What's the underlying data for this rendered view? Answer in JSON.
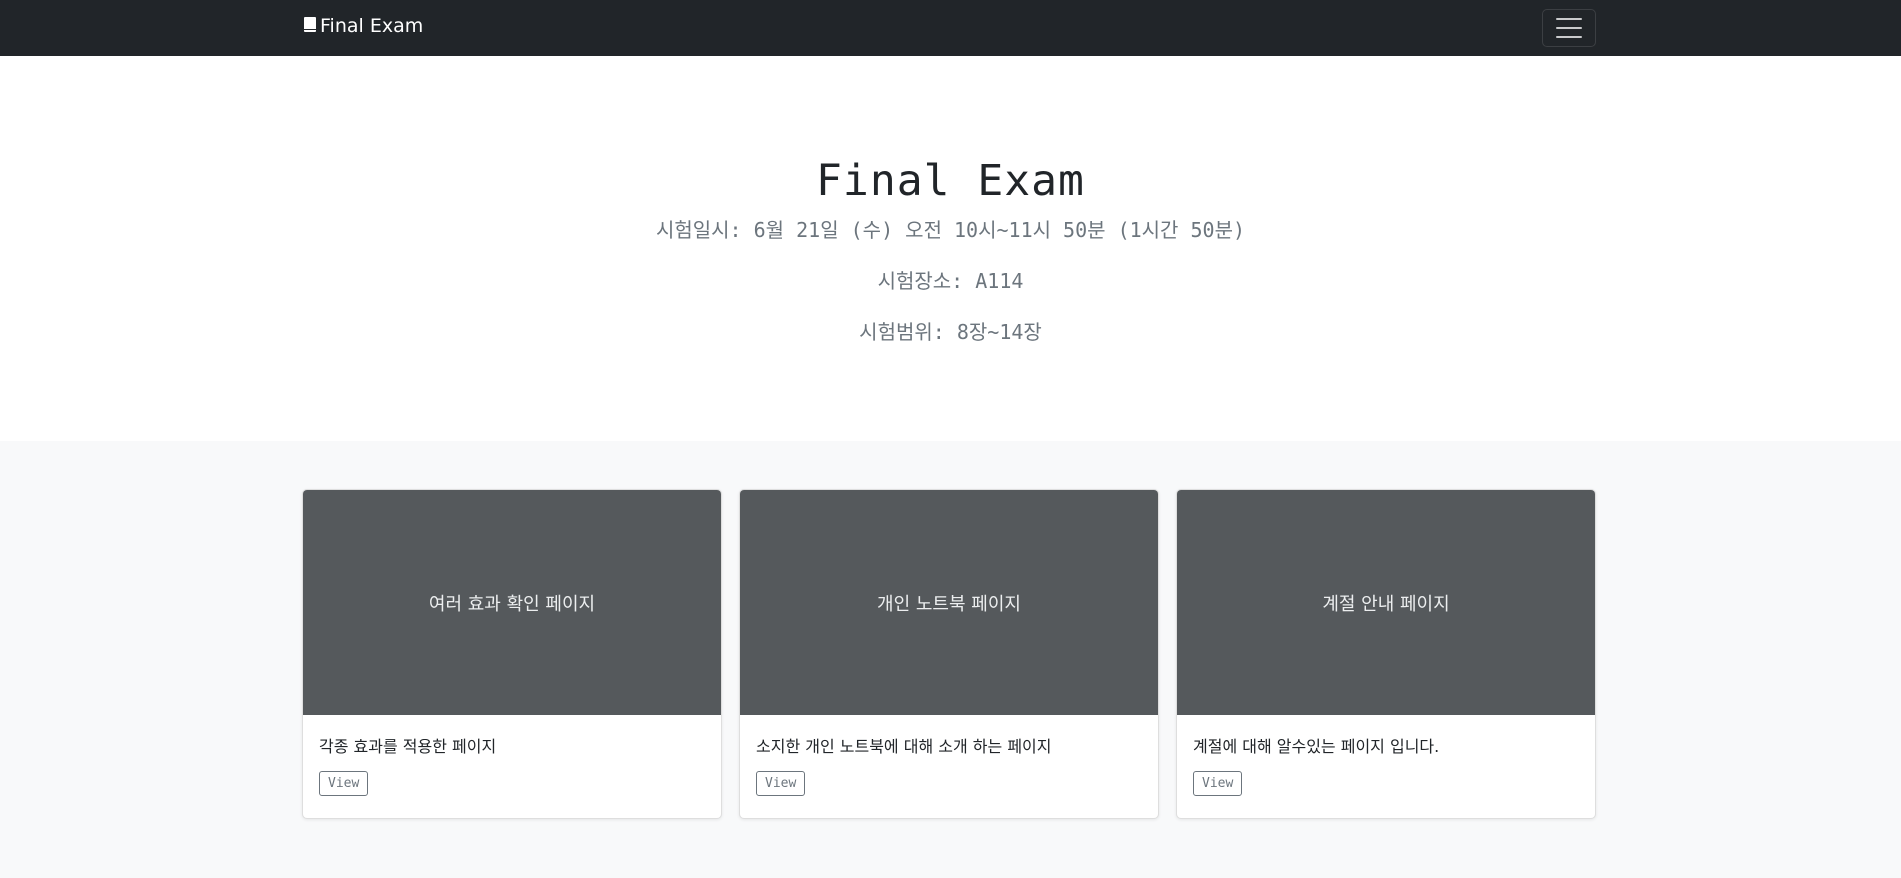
{
  "navbar": {
    "brand": "Final Exam",
    "brand_icon": "book-icon",
    "toggler_icon": "hamburger-menu-icon"
  },
  "hero": {
    "title": "Final Exam",
    "date_line": "시험일시: 6월 21일 (수) 오전 10시~11시 50분 (1시간 50분)",
    "place_line": "시험장소: A114",
    "scope_line": "시험범위: 8장~14장"
  },
  "cards": [
    {
      "thumb": "여러 효과 확인 페이지",
      "text": "각종 효과를 적용한 페이지",
      "button": "View"
    },
    {
      "thumb": "개인 노트북 페이지",
      "text": "소지한 개인 노트북에 대해 소개 하는 페이지",
      "button": "View"
    },
    {
      "thumb": "계절 안내 페이지",
      "text": "계절에 대해 알수있는 페이지 입니다.",
      "button": "View"
    }
  ],
  "colors": {
    "navbar_bg": "#212529",
    "thumb_bg": "#55595c",
    "album_bg": "#f8f9fa",
    "muted_text": "#6c757d"
  }
}
